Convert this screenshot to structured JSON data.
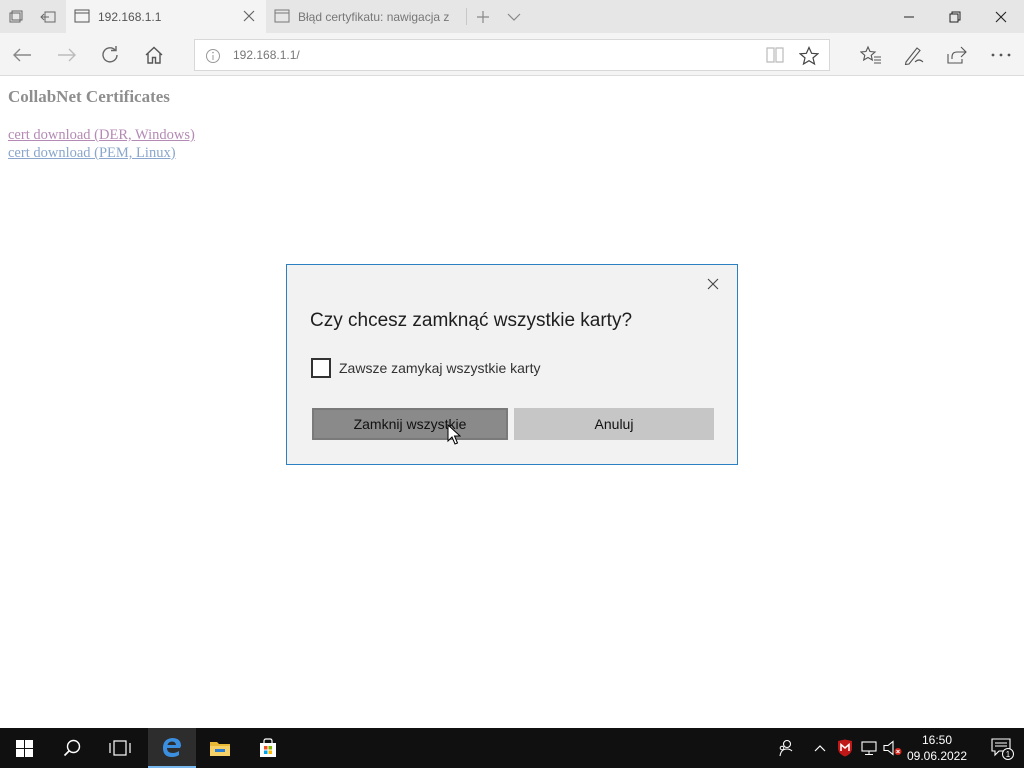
{
  "tabs": [
    {
      "title": "192.168.1.1",
      "active": true
    },
    {
      "title": "Błąd certyfikatu: nawigacja z",
      "active": false
    }
  ],
  "addressbar": {
    "url": "192.168.1.1/"
  },
  "page": {
    "heading": "CollabNet Certificates",
    "links": [
      "cert download (DER, Windows)",
      "cert download (PEM, Linux)"
    ]
  },
  "dialog": {
    "title": "Czy chcesz zamknąć wszystkie karty?",
    "checkbox_label": "Zawsze zamykaj wszystkie karty",
    "checkbox_checked": false,
    "primary_button": "Zamknij wszystkie",
    "secondary_button": "Anuluj"
  },
  "taskbar": {
    "time": "16:50",
    "date": "09.06.2022",
    "notification_count": "1"
  },
  "colors": {
    "accent": "#2b7fc2",
    "taskbar": "#101010",
    "primary_button": "#8a8a8a",
    "secondary_button": "#c6c6c6"
  }
}
